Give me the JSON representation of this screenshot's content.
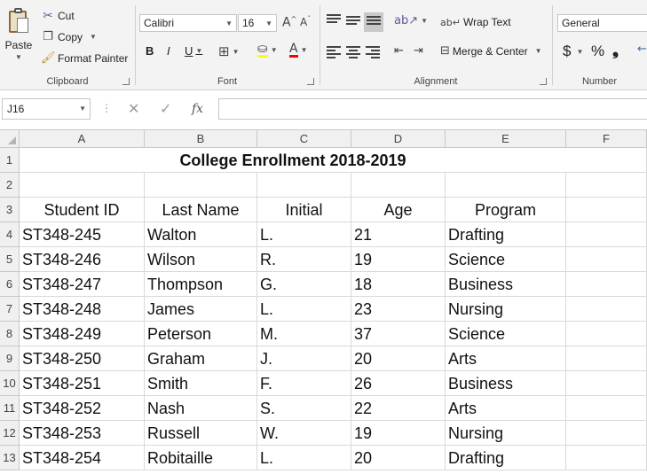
{
  "ribbon": {
    "clipboard": {
      "label": "Clipboard",
      "paste": "Paste",
      "cut": "Cut",
      "copy": "Copy",
      "format_painter": "Format Painter"
    },
    "font": {
      "label": "Font",
      "font_name": "Calibri",
      "font_size": "16",
      "bold": "B",
      "italic": "I",
      "underline": "U"
    },
    "alignment": {
      "label": "Alignment",
      "wrap_text": "Wrap Text",
      "merge_center": "Merge & Center"
    },
    "number": {
      "label": "Number",
      "format": "General",
      "currency": "$",
      "percent": "%"
    }
  },
  "formula_bar": {
    "name_box": "J16",
    "formula": ""
  },
  "sheet": {
    "columns": [
      "A",
      "B",
      "C",
      "D",
      "E",
      "F"
    ],
    "rows": [
      "1",
      "2",
      "3",
      "4",
      "5",
      "6",
      "7",
      "8",
      "9",
      "10",
      "11",
      "12",
      "13"
    ],
    "title": "College Enrollment 2018-2019",
    "headers": [
      "Student ID",
      "Last Name",
      "Initial",
      "Age",
      "Program"
    ],
    "records": [
      [
        "ST348-245",
        "Walton",
        "L.",
        "21",
        "Drafting"
      ],
      [
        "ST348-246",
        "Wilson",
        "R.",
        "19",
        "Science"
      ],
      [
        "ST348-247",
        "Thompson",
        "G.",
        "18",
        "Business"
      ],
      [
        "ST348-248",
        "James",
        "L.",
        "23",
        "Nursing"
      ],
      [
        "ST348-249",
        "Peterson",
        "M.",
        "37",
        "Science"
      ],
      [
        "ST348-250",
        "Graham",
        "J.",
        "20",
        "Arts"
      ],
      [
        "ST348-251",
        "Smith",
        "F.",
        "26",
        "Business"
      ],
      [
        "ST348-252",
        "Nash",
        "S.",
        "22",
        "Arts"
      ],
      [
        "ST348-253",
        "Russell",
        "W.",
        "19",
        "Nursing"
      ],
      [
        "ST348-254",
        "Robitaille",
        "L.",
        "20",
        "Drafting"
      ]
    ]
  },
  "colors": {
    "ribbon_bg": "#f3f3f3",
    "header_bg": "#f0f0f0",
    "gridline": "#d9d9d9"
  }
}
